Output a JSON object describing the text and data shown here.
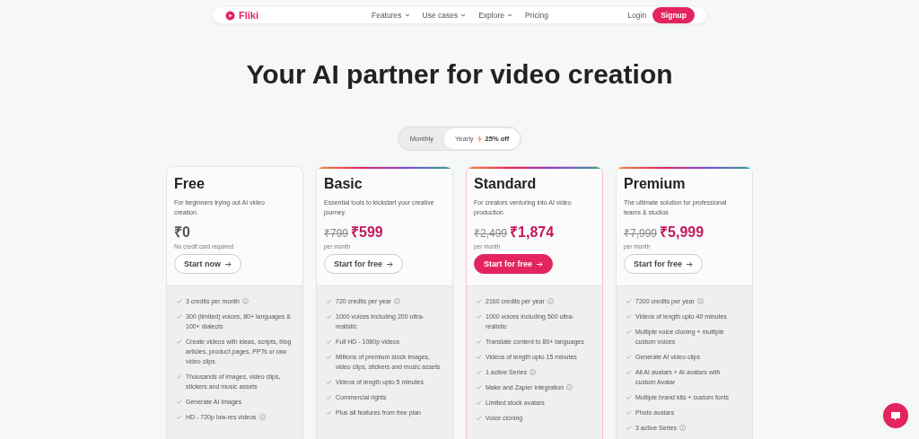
{
  "nav": {
    "brand": "Fliki",
    "links": [
      {
        "label": "Features",
        "dropdown": true
      },
      {
        "label": "Use cases",
        "dropdown": true
      },
      {
        "label": "Explore",
        "dropdown": true
      },
      {
        "label": "Pricing",
        "dropdown": false
      }
    ],
    "login": "Login",
    "signup": "Signup"
  },
  "heading": "Your AI partner for video creation",
  "billing": [
    {
      "label": "Monthly",
      "selected": false
    },
    {
      "label": "Yearly",
      "badge": "25% off",
      "selected": true
    }
  ],
  "plans": [
    {
      "name": "Free",
      "ribbon": false,
      "featured": false,
      "description": "For beginners trying out AI video creation.",
      "price": "₹0",
      "note": "No credit card required",
      "button": "Start now",
      "features": [
        {
          "text": "3 credits per month",
          "info": true
        },
        {
          "text": "300 (limited) voices, 80+ languages & 100+ dialects",
          "info": false
        },
        {
          "text": "Create videos with ideas, scripts, blog articles, product pages, PPTs or raw video clips",
          "info": false
        },
        {
          "text": "Thousands of images, video clips, stickers and music assets",
          "info": false
        },
        {
          "text": "Generate AI Images",
          "info": false
        },
        {
          "text": "HD - 720p low-res videos",
          "info": true
        }
      ]
    },
    {
      "name": "Basic",
      "ribbon": true,
      "featured": false,
      "description": "Essential tools to kickstart your creative journey.",
      "old_price": "₹799",
      "price": "₹599",
      "note": "per month",
      "button": "Start for free",
      "features": [
        {
          "text": "720 credits per year",
          "info": true
        },
        {
          "text": "1000 voices including 200 ultra-realistic",
          "info": false
        },
        {
          "text": "Full HD - 1080p videos",
          "info": false
        },
        {
          "text": "Millions of premium stock images, video clips, stickers and music assets",
          "info": false
        },
        {
          "text": "Videos of length upto 5 minutes",
          "info": false
        },
        {
          "text": "Commercial rights",
          "info": false
        },
        {
          "text": "Plus all features from free plan",
          "info": false
        }
      ]
    },
    {
      "name": "Standard",
      "ribbon": true,
      "featured": true,
      "description": "For creators venturing into AI video production.",
      "old_price": "₹2,499",
      "price": "₹1,874",
      "note": "per month",
      "button": "Start for free",
      "features": [
        {
          "text": "2160 credits per year",
          "info": true
        },
        {
          "text": "1000 voices including 500 ultra-realistic",
          "info": false
        },
        {
          "text": "Translate content to 80+ languages",
          "info": false
        },
        {
          "text": "Videos of length upto 15 minutes",
          "info": false
        },
        {
          "text": "1 active Series",
          "info": true
        },
        {
          "text": "Make and Zapier integration",
          "info": true
        },
        {
          "text": "Limited stock avatars",
          "info": false
        },
        {
          "text": "Voice cloning",
          "info": false
        }
      ]
    },
    {
      "name": "Premium",
      "ribbon": true,
      "featured": false,
      "description": "The ultimate solution for professional teams & studios",
      "old_price": "₹7,999",
      "price": "₹5,999",
      "note": "per month",
      "button": "Start for free",
      "features": [
        {
          "text": "7200 credits per year",
          "info": true
        },
        {
          "text": "Videos of length upto 40 minutes",
          "info": false
        },
        {
          "text": "Multiple voice cloning + multiple custom voices",
          "info": false
        },
        {
          "text": "Generate AI video clips",
          "info": false
        },
        {
          "text": "All AI avatars + AI avatars with custom Avatar",
          "info": false
        },
        {
          "text": "Multiple brand kits + custom fonts",
          "info": false
        },
        {
          "text": "Photo avatars",
          "info": false
        },
        {
          "text": "3 active Series",
          "info": true
        }
      ]
    }
  ]
}
